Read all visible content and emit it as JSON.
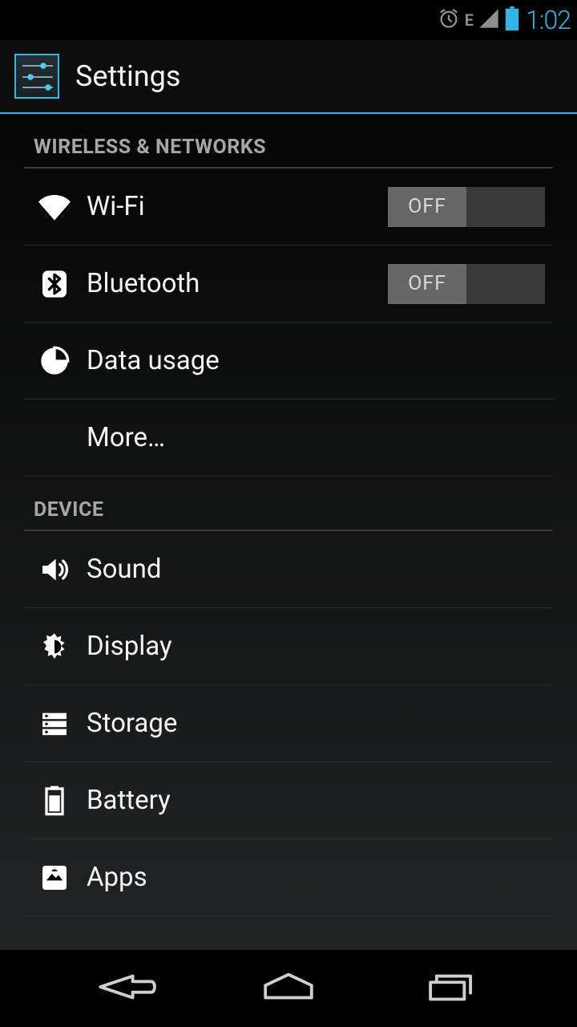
{
  "status_bar": {
    "edge_label": "E",
    "time": "1:02"
  },
  "action_bar": {
    "title": "Settings"
  },
  "sections": {
    "wireless_header": "WIRELESS & NETWORKS",
    "wifi": {
      "label": "Wi-Fi",
      "switch_text": "OFF",
      "switch_on": false
    },
    "bluetooth": {
      "label": "Bluetooth",
      "switch_text": "OFF",
      "switch_on": false
    },
    "data_usage": {
      "label": "Data usage"
    },
    "more": {
      "label": "More…"
    },
    "device_header": "DEVICE",
    "sound": {
      "label": "Sound"
    },
    "display": {
      "label": "Display"
    },
    "storage": {
      "label": "Storage"
    },
    "battery": {
      "label": "Battery"
    },
    "apps": {
      "label": "Apps"
    }
  },
  "colors": {
    "accent": "#33b5e5"
  }
}
